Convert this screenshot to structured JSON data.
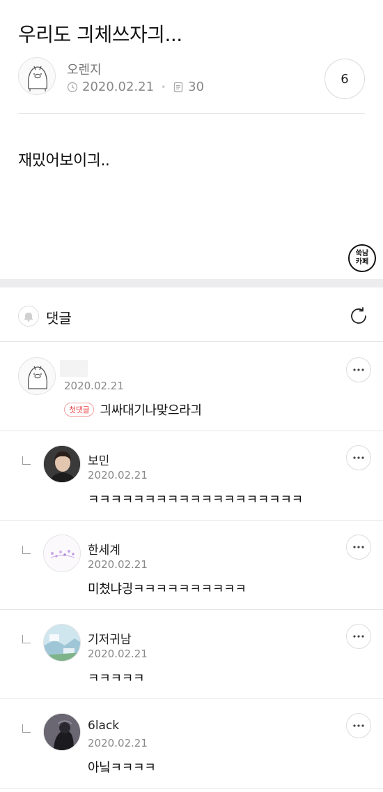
{
  "post": {
    "title": "우리도 긔체쓰자긔...",
    "author": "오렌지",
    "date": "2020.02.21",
    "views": "30",
    "comment_count": "6",
    "body": "재밌어보이긔..",
    "cafe_badge_line1": "쑥남",
    "cafe_badge_line2": "카페"
  },
  "comments_section": {
    "label": "댓글"
  },
  "comments": [
    {
      "nickname": "",
      "date": "2020.02.21",
      "badge": "첫댓글",
      "text": "긔싸대기나맞으라긔"
    },
    {
      "nickname": "보민",
      "date": "2020.02.21",
      "text": "ㅋㅋㅋㅋㅋㅋㅋㅋㅋㅋㅋㅋㅋㅋㅋㅋㅋㅋㅋ"
    },
    {
      "nickname": "한세계",
      "date": "2020.02.21",
      "text": "미쳤냐긩ㅋㅋㅋㅋㅋㅋㅋㅋㅋㅋ"
    },
    {
      "nickname": "기저귀남",
      "date": "2020.02.21",
      "text": "ㅋㅋㅋㅋㅋ"
    },
    {
      "nickname": "6lack",
      "date": "2020.02.21",
      "text": "아닠ㅋㅋㅋㅋ"
    }
  ],
  "colors": {
    "accent_badge": "#e8474a",
    "section_gap": "#ececee",
    "divider": "#e6e6e6"
  },
  "icons": [
    "clock-icon",
    "document-icon",
    "bell-icon",
    "refresh-icon",
    "more-icon",
    "reply-indicator-icon"
  ]
}
